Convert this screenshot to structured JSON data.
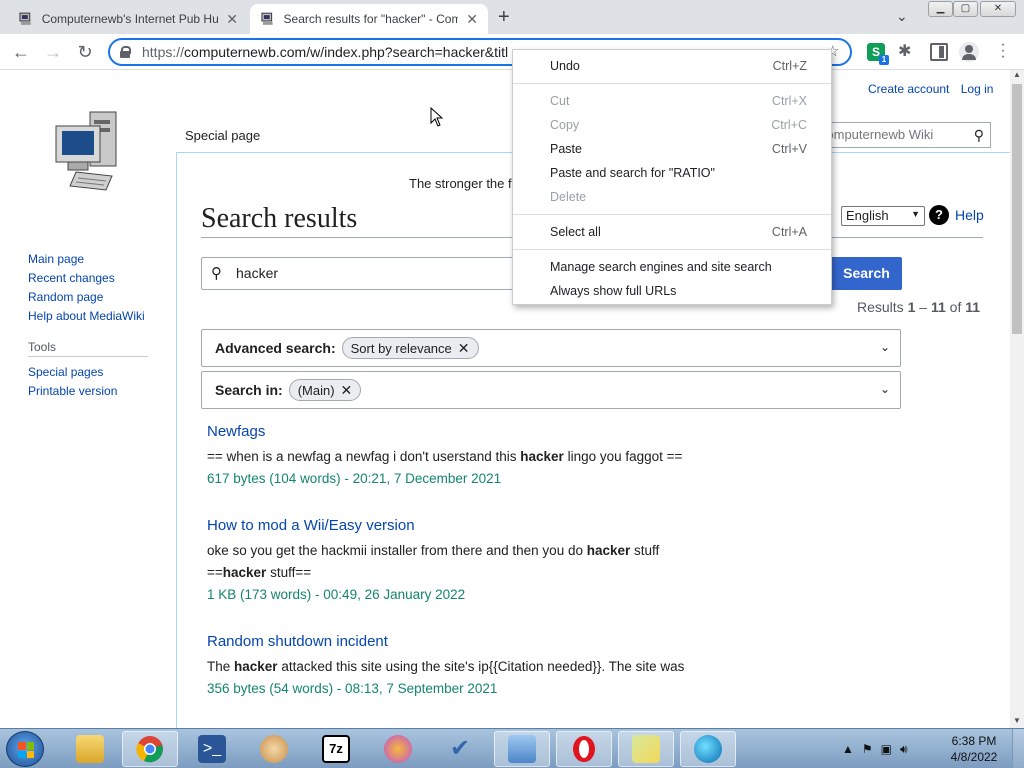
{
  "browser": {
    "tabs": [
      {
        "title": "Computernewb's Internet Pub Hu",
        "active": false
      },
      {
        "title": "Search results for \"hacker\" - Com",
        "active": true
      }
    ],
    "new_tab": "+",
    "url_scheme": "https://",
    "url_rest": "computernewb.com/w/index.php?search=hacker&titl"
  },
  "page": {
    "user_links": {
      "create_account": "Create account",
      "log_in": "Log in"
    },
    "namespace_tab": "Special page",
    "search_box_placeholder": "Computernewb Wiki",
    "site_notice": "The stronger the fo",
    "heading": "Search results",
    "language": "English",
    "help": "Help",
    "query": "hacker",
    "search_button": "Search",
    "results_count": {
      "prefix": "Results ",
      "from": "1",
      "dash": " – ",
      "to": "11",
      "of": " of ",
      "total": "11"
    },
    "advanced": {
      "label": "Advanced search:",
      "chip": "Sort by relevance"
    },
    "search_in": {
      "label": "Search in:",
      "chip": "(Main)"
    },
    "results": [
      {
        "title": "Newfags",
        "snippet_parts": [
          "== when is a newfag a newfag i don't userstand this ",
          "hacker",
          " lingo you faggot =="
        ],
        "meta": "617 bytes (104 words) - 20:21, 7 December 2021"
      },
      {
        "title": "How to mod a Wii/Easy version",
        "snippet_parts": [
          "oke so you get the hackmii installer from there and then you do ",
          "hacker",
          " stuff"
        ],
        "snippet2_parts": [
          "==",
          "hacker",
          " stuff=="
        ],
        "meta": "1 KB (173 words) - 00:49, 26 January 2022"
      },
      {
        "title": "Random shutdown incident",
        "snippet_parts": [
          "The ",
          "hacker",
          " attacked this site using the site's ip{{Citation needed}}. The site was"
        ],
        "meta": "356 bytes (54 words) - 08:13, 7 September 2021"
      }
    ],
    "sidebar": {
      "nav": [
        "Main page",
        "Recent changes",
        "Random page",
        "Help about MediaWiki"
      ],
      "tools_heading": "Tools",
      "tools": [
        "Special pages",
        "Printable version"
      ]
    }
  },
  "context_menu": {
    "items": [
      {
        "label": "Undo",
        "shortcut": "Ctrl+Z",
        "disabled": false
      },
      {
        "label": "Cut",
        "shortcut": "Ctrl+X",
        "disabled": true
      },
      {
        "label": "Copy",
        "shortcut": "Ctrl+C",
        "disabled": true
      },
      {
        "label": "Paste",
        "shortcut": "Ctrl+V",
        "disabled": false
      },
      {
        "label": "Paste and search for \"RATIO\"",
        "shortcut": "",
        "disabled": false
      },
      {
        "label": "Delete",
        "shortcut": "",
        "disabled": true
      },
      {
        "label": "Select all",
        "shortcut": "Ctrl+A",
        "disabled": false
      },
      {
        "label": "Manage search engines and site search",
        "shortcut": "",
        "disabled": false
      },
      {
        "label": "Always show full URLs",
        "shortcut": "",
        "disabled": false
      }
    ]
  },
  "taskbar": {
    "apps": [
      "explorer-icon",
      "chrome-icon",
      "powershell-icon",
      "paint-icon",
      "7zip-icon",
      "clock-app-icon",
      "checkmark-app-icon",
      "control-panel-icon",
      "opera-icon",
      "folder-app-icon",
      "edge-icon"
    ],
    "time": "6:38 PM",
    "date": "4/8/2022"
  },
  "colors": {
    "accent": "#3366cc",
    "link": "#0645ad",
    "meta": "#14866d",
    "omnibox_focus": "#1a73e8"
  }
}
